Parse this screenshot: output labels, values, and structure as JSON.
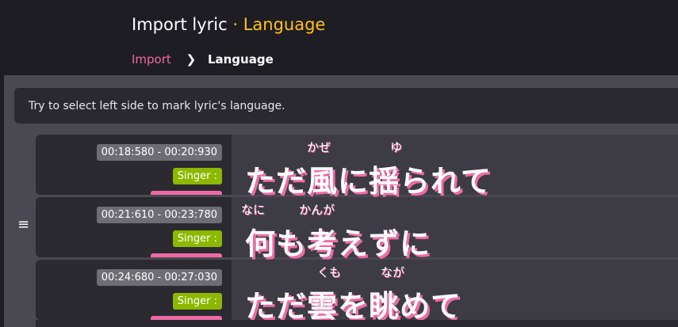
{
  "header": {
    "title_main": "Import lyric",
    "title_sep": " · ",
    "title_accent": "Language"
  },
  "breadcrumb": {
    "items": [
      "Import",
      "Language"
    ]
  },
  "hint": "Try to select left side to mark lyric's language.",
  "rows": [
    {
      "time": "00:18:580 - 00:20:930",
      "singer": "Singer :",
      "lyric": "ただ風に揺られて",
      "ruby": [
        "かぜ",
        "ゆ"
      ]
    },
    {
      "time": "00:21:610 - 00:23:780",
      "singer": "Singer :",
      "lyric": "何も考えずに",
      "ruby": [
        "なに",
        "かんが"
      ]
    },
    {
      "time": "00:24:680 - 00:27:030",
      "singer": "Singer :",
      "lyric": "ただ雲を眺めて",
      "ruby": [
        "くも",
        "なが"
      ]
    }
  ],
  "colors": {
    "accent_yellow": "#ffc21a",
    "accent_pink": "#ef6aa5",
    "singer_green": "#8cb800"
  },
  "icons": {
    "chevron": "chevron-right-icon",
    "handle": "menu-handle-icon"
  }
}
